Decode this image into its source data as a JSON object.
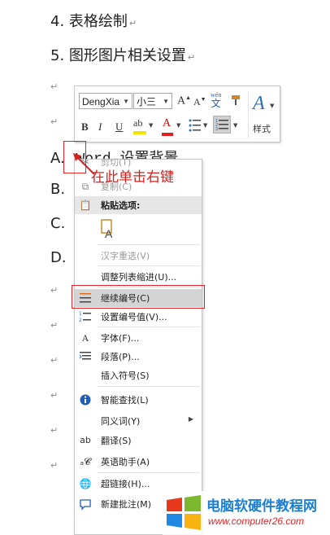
{
  "document": {
    "line4": "4.  表格绘制",
    "line5": "5.  图形图片相关设置",
    "para_mark": "↵",
    "list_a_prefix": "A.",
    "list_a_text": "Word 设置背景",
    "list_b_prefix": "B.",
    "list_c_prefix": "C.",
    "list_d_prefix": "D."
  },
  "mini_toolbar": {
    "font_name": "DengXia",
    "font_size": "小三",
    "grow_font": "A",
    "shrink_font": "A",
    "phonetic_top": "wén",
    "phonetic_bottom": "文",
    "bold": "B",
    "italic": "I",
    "underline": "U",
    "highlight": "ab",
    "font_color": "A",
    "styles_label": "样式",
    "highlight_color": "#f2e600",
    "font_color_bar": "#e02020"
  },
  "annotation": {
    "text": "在此单击右键",
    "color": "#d9201e"
  },
  "context_menu": {
    "cut": "剪切(T)",
    "copy": "复制(C)",
    "paste_header": "粘贴选项:",
    "reconvert": "汉字重选(V)",
    "adjust_indent": "调整列表缩进(U)...",
    "continue_numbering": "继续编号(C)",
    "set_numbering_value": "设置编号值(V)...",
    "font": "字体(F)...",
    "paragraph": "段落(P)...",
    "insert_symbol": "插入符号(S)",
    "smart_lookup": "智能查找(L)",
    "synonyms": "同义词(Y)",
    "translate": "翻译(S)",
    "english_assistant": "英语助手(A)",
    "hyperlink": "超链接(H)...",
    "new_comment": "新建批注(M)"
  },
  "watermark": {
    "title": "电脑软硬件教程网",
    "url": "www.computer26.com",
    "title_color": "#1a7fd4",
    "url_color": "#e0262a"
  }
}
